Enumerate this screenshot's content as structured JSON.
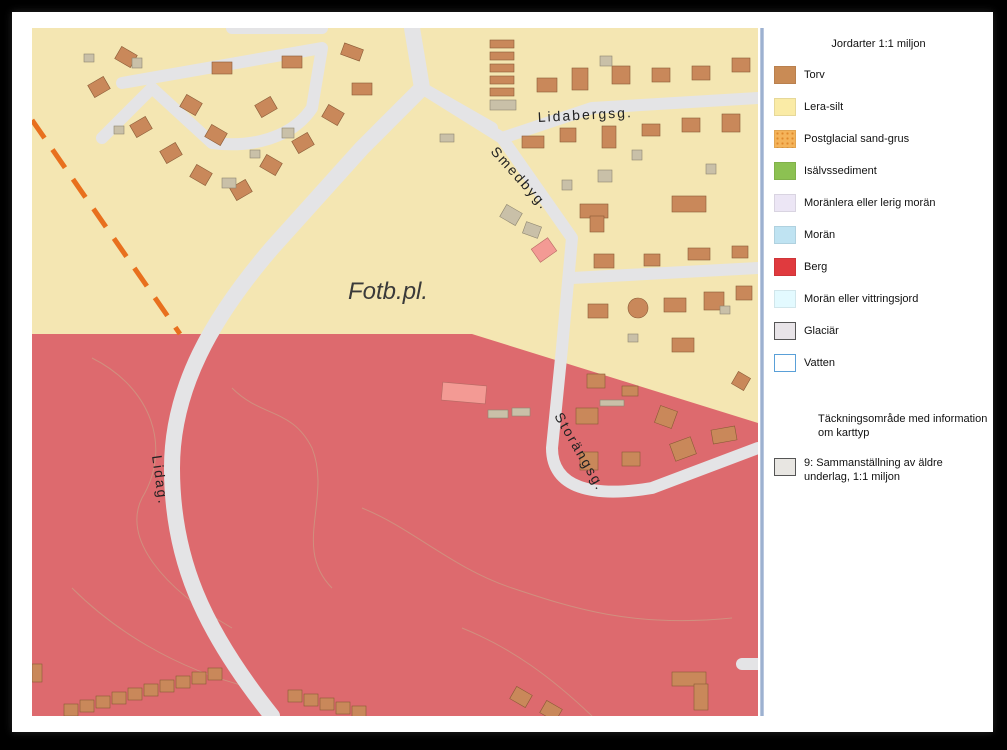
{
  "map": {
    "place_label": "Fotb.pl.",
    "streets": {
      "lidabergsg": "Lidabergsg.",
      "smedbyg": "Smedbyg.",
      "storangsg": "Storängsg.",
      "lidag": "Lidag."
    },
    "colors": {
      "lera_silt": "#f4e6b2",
      "berg": "#dd6a6e",
      "road": "#e4e4e6",
      "building": "#c9885a",
      "building_gray": "#c9c0a8",
      "rail": "#e8701e"
    }
  },
  "legend": {
    "title": "Jordarter 1:1 miljon",
    "items": [
      {
        "label": "Torv",
        "color": "#c98b55"
      },
      {
        "label": "Lera-silt",
        "color": "#faeba6"
      },
      {
        "label": "Postglacial sand-grus",
        "color": "#f5b45a"
      },
      {
        "label": "Isälvssediment",
        "color": "#8cc152"
      },
      {
        "label": "Moränlera eller lerig morän",
        "color": "#ece6f5"
      },
      {
        "label": "Morän",
        "color": "#bfe3f2"
      },
      {
        "label": "Berg",
        "color": "#e03a3e"
      },
      {
        "label": "Morän eller vittringsjord",
        "color": "#e3faff"
      },
      {
        "label": "Glaciär",
        "color": "#e8e4e8"
      },
      {
        "label": "Vatten",
        "color": "#ffffff"
      }
    ],
    "coverage_heading": "Täckningsområde med information om karttyp",
    "coverage_item": {
      "label": "9: Sammanställning av äldre underlag, 1:1 miljon",
      "color": "#e8e6e2"
    }
  }
}
